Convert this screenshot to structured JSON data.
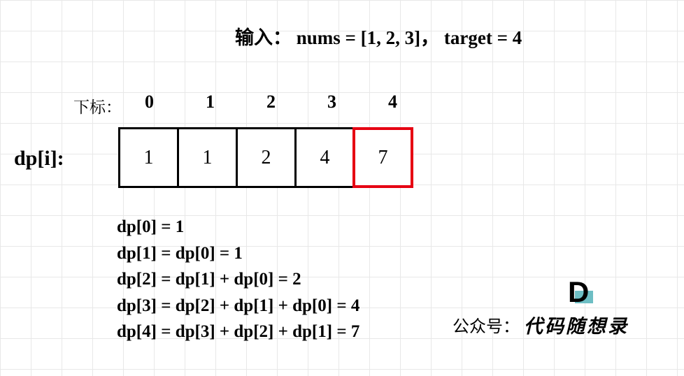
{
  "input_line": "输入： nums = [1, 2, 3]， target = 4",
  "index_label": "下标：",
  "indices": [
    "0",
    "1",
    "2",
    "3",
    "4"
  ],
  "dp_label": "dp[i]:",
  "dp_values": [
    "1",
    "1",
    "2",
    "4",
    "7"
  ],
  "highlight_index": 4,
  "equations": [
    "dp[0] = 1",
    "dp[1] = dp[0] = 1",
    "dp[2] = dp[1] + dp[0] = 2",
    "dp[3] = dp[2] + dp[1] + dp[0] = 4",
    "dp[4] = dp[3] + dp[2] + dp[1] = 7"
  ],
  "attribution": {
    "prefix": "公众号：",
    "brand": "代码随想录"
  },
  "chart_data": {
    "type": "table",
    "title": "Dynamic Programming array dp[i] for combination sum IV",
    "input": {
      "nums": [
        1,
        2,
        3
      ],
      "target": 4
    },
    "columns": [
      "index",
      "dp[i]"
    ],
    "rows": [
      {
        "index": 0,
        "dp": 1
      },
      {
        "index": 1,
        "dp": 1
      },
      {
        "index": 2,
        "dp": 2
      },
      {
        "index": 3,
        "dp": 4
      },
      {
        "index": 4,
        "dp": 7
      }
    ],
    "highlighted_index": 4,
    "recurrences": [
      "dp[0] = 1",
      "dp[1] = dp[0] = 1",
      "dp[2] = dp[1] + dp[0] = 2",
      "dp[3] = dp[2] + dp[1] + dp[0] = 4",
      "dp[4] = dp[3] + dp[2] + dp[1] = 7"
    ]
  }
}
